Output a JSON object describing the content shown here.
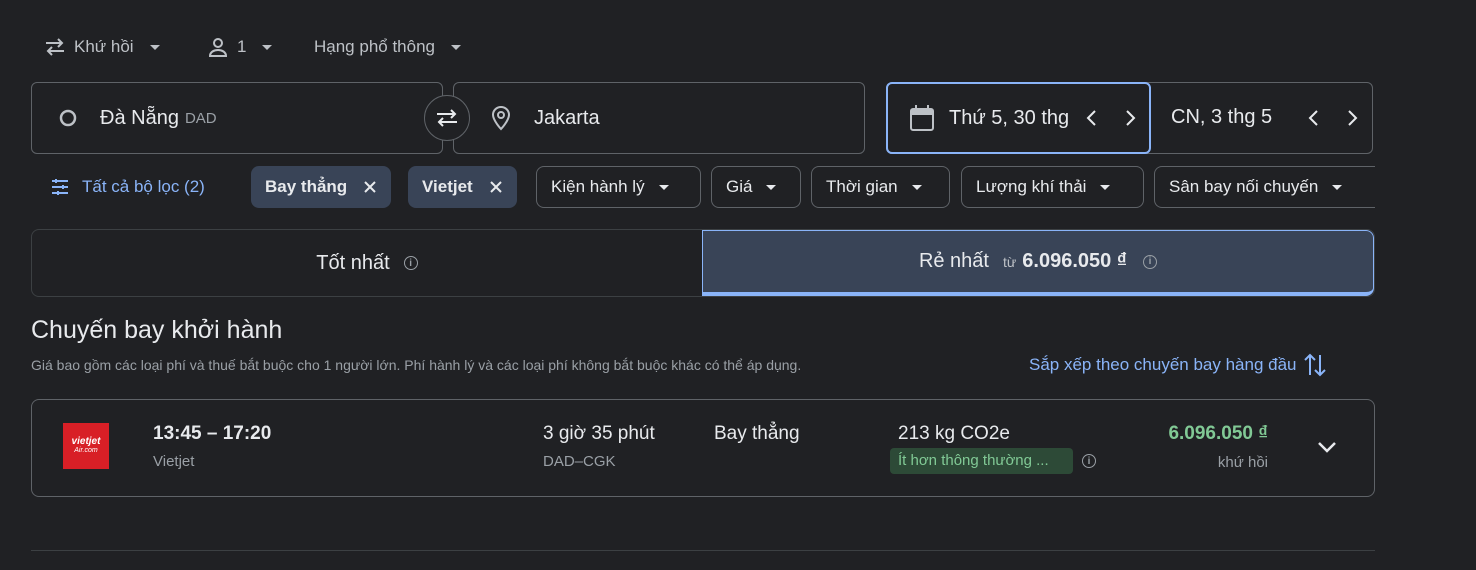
{
  "trip_options": {
    "trip_type": "Khứ hồi",
    "passengers": "1",
    "cabin_class": "Hạng phổ thông"
  },
  "search": {
    "origin_name": "Đà Nẵng",
    "origin_code": "DAD",
    "destination": "Jakarta",
    "depart_date": "Thứ 5, 30 thg",
    "return_date": "CN, 3 thg 5"
  },
  "filters": {
    "all_filters": "Tất cả bộ lọc (2)",
    "active": [
      "Bay thẳng",
      "Vietjet"
    ],
    "dropdowns": [
      "Kiện hành lý",
      "Giá",
      "Thời gian",
      "Lượng khí thải",
      "Sân bay nối chuyến"
    ]
  },
  "sort_tabs": {
    "best": "Tốt nhất",
    "cheapest": "Rẻ nhất",
    "cheapest_prefix": "từ",
    "cheapest_price": "6.096.050 ₫"
  },
  "section": {
    "title": "Chuyến bay khởi hành",
    "subtitle": "Giá bao gồm các loại phí và thuế bắt buộc cho 1 người lớn. Phí hành lý và các loại phí không bắt buộc khác có thể áp dụng.",
    "sort_label": "Sắp xếp theo chuyến bay hàng đầu"
  },
  "flights": [
    {
      "logo_text_1": "vietjet",
      "logo_text_2": "Air.com",
      "times": "13:45 – 17:20",
      "airline": "Vietjet",
      "duration": "3 giờ 35 phút",
      "route": "DAD–CGK",
      "stops": "Bay thẳng",
      "emissions": "213 kg CO2e",
      "emissions_badge": "Ít hơn thông thường ...",
      "price": "6.096.050 ₫",
      "price_note": "khứ hồi"
    }
  ],
  "colors": {
    "background": "#202124",
    "accent_blue": "#8ab4f8",
    "price_green": "#81c995",
    "chip_fill": "#394457",
    "eco_badge": "#2d4a37",
    "vietjet_red": "#d81f26"
  }
}
